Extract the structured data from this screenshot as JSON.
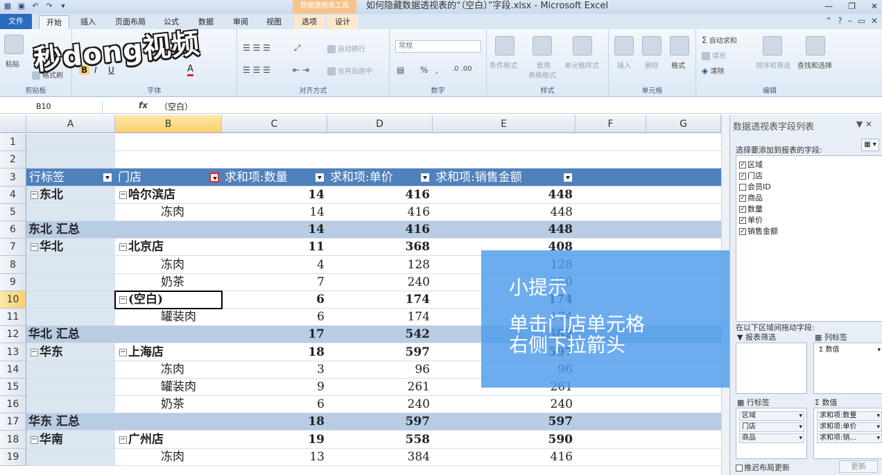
{
  "window": {
    "title": "如何隐藏数据透视表的“（空白）”字段.xlsx - Microsoft Excel",
    "context_tab_header": "数据透视表工具"
  },
  "tabs": [
    "文件",
    "开始",
    "插入",
    "页面布局",
    "公式",
    "数据",
    "审阅",
    "视图",
    "选项",
    "设计"
  ],
  "watermark": "秒dong视频",
  "ribbon": {
    "clipboard": {
      "paste": "粘贴",
      "format_painter": "格式刷",
      "group": "剪贴板"
    },
    "font": {
      "group": "字体",
      "bold": "B",
      "italic": "I",
      "underline": "U",
      "font_color": "A"
    },
    "alignment": {
      "wrap": "自动换行",
      "merge": "合并后居中",
      "group": "对齐方式"
    },
    "number": {
      "format": "常规",
      "percent": "%",
      "comma": ",",
      "group": "数字"
    },
    "styles": {
      "conditional": "条件格式",
      "table_format_1": "套用",
      "table_format_2": "表格格式",
      "cell_styles": "单元格样式",
      "group": "样式"
    },
    "cells": {
      "insert": "插入",
      "delete": "删除",
      "format": "格式",
      "group": "单元格"
    },
    "editing": {
      "autosum": "自动求和",
      "fill": "填充",
      "clear": "清除",
      "sort": "排序和筛选",
      "find": "查找和选择",
      "group": "编辑"
    }
  },
  "formula_bar": {
    "name_box": "B10",
    "fx": "fx",
    "content": "（空白）"
  },
  "columns": [
    "A",
    "B",
    "C",
    "D",
    "E",
    "F",
    "G"
  ],
  "rows": [
    {
      "n": "1",
      "type": "empty",
      "a": "",
      "b": "",
      "c": "",
      "d": "",
      "e": ""
    },
    {
      "n": "2",
      "type": "empty",
      "a": "",
      "b": "",
      "c": "",
      "d": "",
      "e": ""
    },
    {
      "n": "3",
      "type": "header",
      "a": "行标签",
      "b": "门店",
      "c": "求和项:数量",
      "d": "求和项:单价",
      "e": "求和项:销售金额"
    },
    {
      "n": "4",
      "type": "group",
      "a": "东北",
      "b": "哈尔滨店",
      "c": "14",
      "d": "416",
      "e": "448"
    },
    {
      "n": "5",
      "type": "item",
      "a": "",
      "b": "冻肉",
      "c": "14",
      "d": "416",
      "e": "448"
    },
    {
      "n": "6",
      "type": "subtotal",
      "a": "东北 汇总",
      "b": "",
      "c": "14",
      "d": "416",
      "e": "448"
    },
    {
      "n": "7",
      "type": "group",
      "a": "华北",
      "b": "北京店",
      "c": "11",
      "d": "368",
      "e": "408"
    },
    {
      "n": "8",
      "type": "item",
      "a": "",
      "b": "冻肉",
      "c": "4",
      "d": "128",
      "e": "128"
    },
    {
      "n": "9",
      "type": "item",
      "a": "",
      "b": "奶茶",
      "c": "7",
      "d": "240",
      "e": "280"
    },
    {
      "n": "10",
      "type": "group2",
      "a": "",
      "b": "(空白)",
      "c": "6",
      "d": "174",
      "e": "174"
    },
    {
      "n": "11",
      "type": "item",
      "a": "",
      "b": "罐装肉",
      "c": "6",
      "d": "174",
      "e": "174"
    },
    {
      "n": "12",
      "type": "subtotal",
      "a": "华北 汇总",
      "b": "",
      "c": "17",
      "d": "542",
      "e": "582"
    },
    {
      "n": "13",
      "type": "group",
      "a": "华东",
      "b": "上海店",
      "c": "18",
      "d": "597",
      "e": "597"
    },
    {
      "n": "14",
      "type": "item",
      "a": "",
      "b": "冻肉",
      "c": "3",
      "d": "96",
      "e": "96"
    },
    {
      "n": "15",
      "type": "item",
      "a": "",
      "b": "罐装肉",
      "c": "9",
      "d": "261",
      "e": "261"
    },
    {
      "n": "16",
      "type": "item",
      "a": "",
      "b": "奶茶",
      "c": "6",
      "d": "240",
      "e": "240"
    },
    {
      "n": "17",
      "type": "subtotal",
      "a": "华东 汇总",
      "b": "",
      "c": "18",
      "d": "597",
      "e": "597"
    },
    {
      "n": "18",
      "type": "group",
      "a": "华南",
      "b": "广州店",
      "c": "19",
      "d": "558",
      "e": "590"
    },
    {
      "n": "19",
      "type": "item",
      "a": "",
      "b": "冻肉",
      "c": "13",
      "d": "384",
      "e": "416"
    }
  ],
  "tip": {
    "title": "小提示",
    "line1": "单击门店单元格",
    "line2": "右侧下拉箭头"
  },
  "field_list": {
    "title": "数据透视表字段列表",
    "choose_label": "选择要添加到报表的字段:",
    "fields": [
      {
        "name": "区域",
        "checked": "✓"
      },
      {
        "name": "门店",
        "checked": "✓"
      },
      {
        "name": "会员ID",
        "checked": ""
      },
      {
        "name": "商品",
        "checked": "✓"
      },
      {
        "name": "数量",
        "checked": "✓"
      },
      {
        "name": "单价",
        "checked": "✓"
      },
      {
        "name": "销售金额",
        "checked": "✓"
      }
    ],
    "drag_label": "在以下区域间拖动字段:",
    "report_filter": "报表筛选",
    "column_labels": "列标签",
    "column_values": [
      "数值"
    ],
    "row_labels": "行标签",
    "row_items": [
      "区域",
      "门店",
      "商品"
    ],
    "values": "数值",
    "value_items": [
      "求和项:数量",
      "求和项:单价",
      "求和项:销..."
    ],
    "defer": "推迟布局更新",
    "update": "更新"
  }
}
